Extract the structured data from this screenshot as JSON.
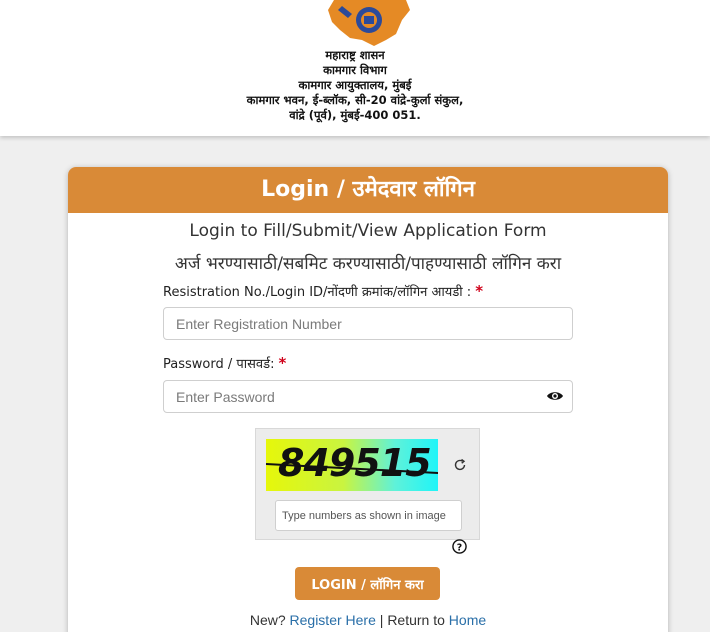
{
  "header": {
    "org_lines": [
      "महाराष्ट्र शासन",
      "कामगार विभाग",
      "कामगार आयुक्तालय, मुंबई",
      "कामगार भवन, ई-ब्लॉक, सी-20 वांद्रे-कुर्ला संकुल,",
      "वांद्रे (पूर्व), मुंबई-400 051."
    ]
  },
  "card": {
    "title": "Login / उमेदवार लॉगिन",
    "subtitle_en": "Login to Fill/Submit/View Application Form",
    "subtitle_mr": "अर्ज भरण्यासाठी/सबमिट करण्यासाठी/पाहण्यासाठी लॉगिन करा",
    "reg_label": "Resistration No./Login ID/नोंदणी क्रमांक/लॉगिन आयडी :",
    "reg_placeholder": "Enter Registration Number",
    "password_label": "Password / पासवर्ड:",
    "password_placeholder": "Enter Password",
    "required_mark": "*",
    "captcha_value": "849515",
    "captcha_placeholder": "Type numbers as shown in image",
    "login_button": "LOGIN / लॉगिन करा",
    "footer_new": "New?",
    "footer_register": "Register Here",
    "footer_sep": "|",
    "footer_return": "Return to",
    "footer_home": "Home"
  },
  "colors": {
    "accent": "#d98a37",
    "link": "#2a6fa8",
    "required": "#d0021b"
  },
  "icons": [
    "emblem-logo-icon",
    "eye-icon",
    "refresh-icon",
    "help-icon"
  ]
}
